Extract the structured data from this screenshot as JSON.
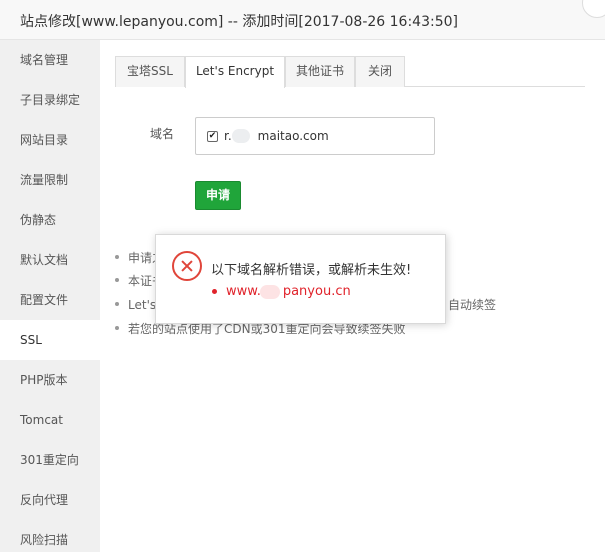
{
  "window": {
    "title": "站点修改[www.lepanyou.com] -- 添加时间[2017-08-26 16:43:50]"
  },
  "sidebar": {
    "items": [
      {
        "label": "域名管理"
      },
      {
        "label": "子目录绑定"
      },
      {
        "label": "网站目录"
      },
      {
        "label": "流量限制"
      },
      {
        "label": "伪静态"
      },
      {
        "label": "默认文档"
      },
      {
        "label": "配置文件"
      },
      {
        "label": "SSL"
      },
      {
        "label": "PHP版本"
      },
      {
        "label": "Tomcat"
      },
      {
        "label": "301重定向"
      },
      {
        "label": "反向代理"
      },
      {
        "label": "风险扫描"
      }
    ],
    "active_index": 7
  },
  "tabs": [
    {
      "label": "宝塔SSL"
    },
    {
      "label": "Let's Encrypt"
    },
    {
      "label": "其他证书"
    },
    {
      "label": "关闭"
    }
  ],
  "form": {
    "domain_label": "域名",
    "domain_checked": true,
    "domain_prefix": "r.",
    "domain_suffix": "maitao.com",
    "apply_label": "申请"
  },
  "notes": [
    {
      "text": "申请之"
    },
    {
      "text": "本证书"
    },
    {
      "text": "Let's",
      "tail": "自动续签"
    },
    {
      "text": "若您的站点使用了CDN或301重定向会导致续签失败"
    }
  ],
  "dialog": {
    "message": "以下域名解析错误，或解析未生效!",
    "domain_prefix": "www.",
    "domain_suffix": "panyou.cn"
  },
  "colors": {
    "accent_green": "#20a53a",
    "error_red": "#e0232b",
    "sidebar_bg": "#f0f0f0"
  }
}
